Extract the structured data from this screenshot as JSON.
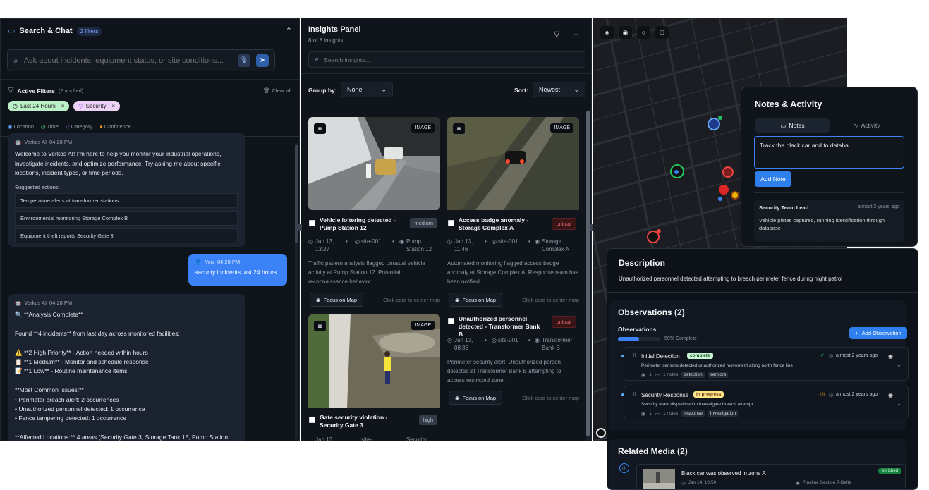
{
  "chat": {
    "title": "Search & Chat",
    "filters_badge": "2 filters",
    "search_placeholder": "Ask about incidents, equipment status, or site conditions...",
    "active_filters_label": "Active Filters",
    "applied_count": "(2 applied)",
    "clear_all": "Clear all",
    "chips": [
      {
        "label": "Last 24 Hours"
      },
      {
        "label": "Security"
      }
    ],
    "legend": [
      "Location",
      "Time",
      "Category",
      "Confidence"
    ],
    "ai_name": "Verkos AI",
    "welcome_time": "04:28 PM",
    "welcome_text": "Welcome to Verkos AI! I'm here to help you monitor your industrial operations, investigate incidents, and optimize performance. Try asking me about specific locations, incident types, or time periods.",
    "suggested_label": "Suggested actions:",
    "suggestions": [
      "Temperature alerts at transformer stations",
      "Environmental monitoring Storage Complex B",
      "Equipment theft reports Security Gate 3"
    ],
    "user_name": "You",
    "user_time": "04:28 PM",
    "user_text": "security incidents last 24 hours",
    "reply_time": "04:28 PM",
    "reply_lines": [
      "🔍 **Analysis Complete**",
      "",
      "Found **4 incidents** from last day across monitored facilities:",
      "",
      "⚠️ **2 High Priority** - Action needed within hours",
      "📋 **1 Medium** - Monitor and schedule response",
      "📝 **1 Low** - Routine maintenance items",
      "",
      "**Most Common Issues:**",
      "• Perimeter breach alert: 2 occurrences",
      "• Unauthorized personnel detected: 1 occurrence",
      "• Fence tampering detected: 1 occurrence",
      "",
      "**Affected Locations:** 4 areas (Security Gate 3, Storage Tank 15, Pump Station"
    ]
  },
  "insights": {
    "title": "Insights Panel",
    "count": "8 of 8 insights",
    "search_placeholder": "Search insights...",
    "group_label": "Group by:",
    "group_value": "None",
    "sort_label": "Sort:",
    "sort_value": "Newest",
    "focus_label": "Focus on Map",
    "click_hint": "Click card to center map",
    "image_badge": "IMAGE",
    "cards": [
      {
        "title": "Vehicle loitering detected - Pump Station 12",
        "severity": "medium",
        "date": "Jan 13, 13:27",
        "site": "site-001",
        "loc": "Pump Station 12",
        "desc": "Traffic pattern analysis flagged unusual vehicle activity at Pump Station 12. Potential reconnaissance behavior."
      },
      {
        "title": "Access badge anomaly - Storage Complex A",
        "severity": "critical",
        "date": "Jan 13, 11:46",
        "site": "site-001",
        "loc": "Storage Complex A",
        "desc": "Automated monitoring flagged access badge anomaly at Storage Complex A. Response team has been notified."
      },
      {
        "title": "Unauthorized personnel detected - Transformer Bank B",
        "severity": "critical",
        "date": "Jan 13, 08:36",
        "site": "site-001",
        "loc": "Transformer Bank B",
        "desc": "Perimeter security alert: Unauthorized person detected at Transformer Bank B attempting to access restricted zone."
      },
      {
        "title": "Gate security violation - Security Gate 3",
        "severity": "high",
        "date": "Jan 13,",
        "site": "site-",
        "loc": "Security"
      }
    ]
  },
  "notes": {
    "title": "Notes & Activity",
    "tab_notes": "Notes",
    "tab_activity": "Activity",
    "draft": "Track the black car and to databa",
    "add_button": "Add Note",
    "entry_author": "Security Team Lead",
    "entry_time": "almost 2 years ago",
    "entry_text": "Vehicle plates captured, running identification through database"
  },
  "detail": {
    "desc_title": "Description",
    "desc_text": "Unauthorized personnel detected attempting to breach perimeter fence during night patrol",
    "obs_title": "Observations (2)",
    "obs_sub": "Observations",
    "progress_pct": 50,
    "progress_text": "50% Complete",
    "add_obs": "Add Observation",
    "observations": [
      {
        "title": "Initial Detection",
        "status": "complete",
        "time": "almost 2 years ago",
        "desc": "Perimeter sensors detected unauthorized movement along north fence line",
        "count": "1",
        "notes": "1 notes",
        "tags": [
          "detection",
          "sensors"
        ]
      },
      {
        "title": "Security Response",
        "status": "in progress",
        "time": "almost 2 years ago",
        "desc": "Security team dispatched to investigate breach attempt",
        "count": "1",
        "notes": "1 notes",
        "tags": [
          "response",
          "investigation"
        ]
      }
    ],
    "media_title": "Related Media (2)",
    "media_item_title": "Black car was observed in zone A",
    "media_item_date": "Jan 14, 19:50",
    "media_item_loc": "Pipeline Section 7-Delta",
    "media_item_badge": "enriched"
  },
  "colors": {
    "accent": "#3b82f6",
    "critical": "#f87171",
    "bg": "#0f141b"
  }
}
